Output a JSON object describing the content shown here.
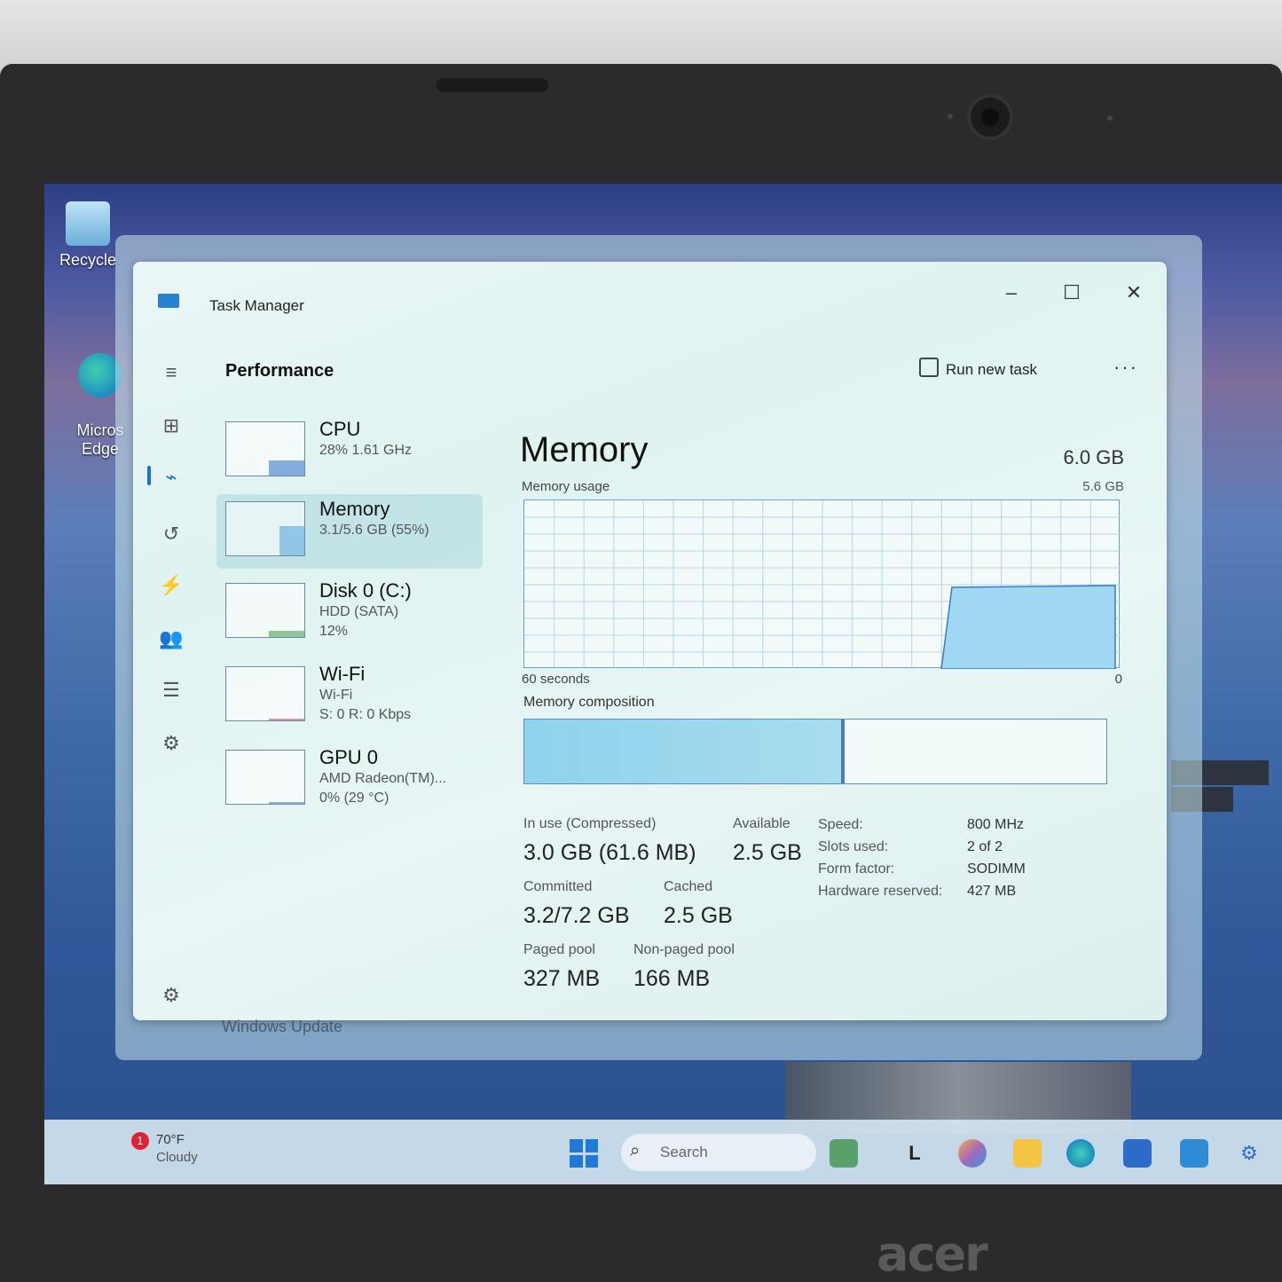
{
  "desktop": {
    "icons": [
      {
        "label": "Recycle",
        "icon": "recycle-bin-icon"
      },
      {
        "label": "Micros\nEdge",
        "icon": "edge-icon"
      }
    ]
  },
  "window": {
    "title": "Task Manager",
    "controls": {
      "minimize": "–",
      "maximize": "☐",
      "close": "✕"
    }
  },
  "nav": [
    {
      "icon": "hamburger-menu-icon",
      "glyph": "≡"
    },
    {
      "icon": "processes-icon",
      "glyph": "⊞"
    },
    {
      "icon": "performance-icon",
      "glyph": "⌁",
      "active": true
    },
    {
      "icon": "app-history-icon",
      "glyph": "↺"
    },
    {
      "icon": "startup-apps-icon",
      "glyph": "⚡"
    },
    {
      "icon": "users-icon",
      "glyph": "👥"
    },
    {
      "icon": "details-icon",
      "glyph": "☰"
    },
    {
      "icon": "services-icon",
      "glyph": "⚙"
    },
    {
      "icon": "settings-icon",
      "glyph": "⚙"
    }
  ],
  "header": {
    "title": "Performance",
    "run_new_task": "Run new task",
    "more": "···"
  },
  "resources": [
    {
      "name": "CPU",
      "line1": "28%  1.61 GHz",
      "line2": "",
      "active": false,
      "usage": 0.28
    },
    {
      "name": "Memory",
      "line1": "3.1/5.6 GB (55%)",
      "line2": "",
      "active": true,
      "usage": 0.55
    },
    {
      "name": "Disk 0 (C:)",
      "line1": "HDD (SATA)",
      "line2": "12%",
      "active": false,
      "usage": 0.12
    },
    {
      "name": "Wi-Fi",
      "line1": "Wi-Fi",
      "line2": "S: 0  R: 0 Kbps",
      "active": false,
      "usage": 0.0
    },
    {
      "name": "GPU 0",
      "line1": "AMD Radeon(TM)...",
      "line2": "0%  (29 °C)",
      "active": false,
      "usage": 0.0
    }
  ],
  "memory": {
    "title": "Memory",
    "total": "6.0 GB",
    "usage_label": "Memory usage",
    "usage_max": "5.6 GB",
    "x_left": "60 seconds",
    "x_right": "0",
    "composition_label": "Memory composition",
    "in_use_fraction": 0.55,
    "stats": {
      "in_use_label": "In use (Compressed)",
      "in_use_value": "3.0 GB (61.6 MB)",
      "available_label": "Available",
      "available_value": "2.5 GB",
      "committed_label": "Committed",
      "committed_value": "3.2/7.2 GB",
      "cached_label": "Cached",
      "cached_value": "2.5 GB",
      "paged_label": "Paged pool",
      "paged_value": "327 MB",
      "nonpaged_label": "Non-paged pool",
      "nonpaged_value": "166 MB"
    },
    "props": {
      "speed_label": "Speed:",
      "speed_value": "800 MHz",
      "slots_label": "Slots used:",
      "slots_value": "2 of 2",
      "form_label": "Form factor:",
      "form_value": "SODIMM",
      "reserved_label": "Hardware reserved:",
      "reserved_value": "427 MB"
    }
  },
  "behind_window_text": "Windows Update",
  "taskbar": {
    "weather_badge": "1",
    "weather_temp": "70°F",
    "weather_cond": "Cloudy",
    "search_placeholder": "Search",
    "apps": [
      "widgets-icon",
      "terminal-icon",
      "copilot-icon",
      "file-explorer-icon",
      "edge-icon",
      "store-icon",
      "mail-icon",
      "settings-icon"
    ]
  },
  "laptop_brand": "acer",
  "colors": {
    "accent": "#1a6fd0",
    "memory_fill": "#9fd8f0",
    "graph_border": "#6ea0c8"
  }
}
